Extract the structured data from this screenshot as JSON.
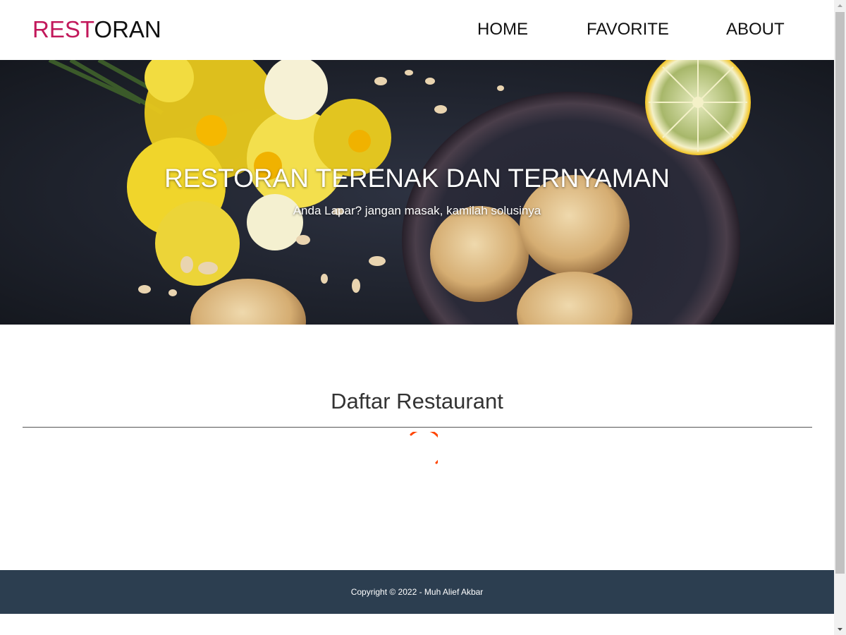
{
  "header": {
    "logo_accent": "REST",
    "logo_rest": "ORAN",
    "nav": {
      "home": "HOME",
      "favorite": "FAVORITE",
      "about": "ABOUT"
    }
  },
  "hero": {
    "title": "RESTORAN TERENAK DAN TERNYAMAN",
    "subtitle": "Anda Lapar? jangan masak, kamilah solusinya"
  },
  "main": {
    "section_title": "Daftar Restaurant",
    "loading_indicator": "spinner-icon"
  },
  "footer": {
    "copyright": "Copyright © 2022 - Muh Alief Akbar"
  },
  "colors": {
    "logo_accent": "#c2185b",
    "footer_bg": "#2c3e50",
    "spinner": "#ff4500"
  }
}
